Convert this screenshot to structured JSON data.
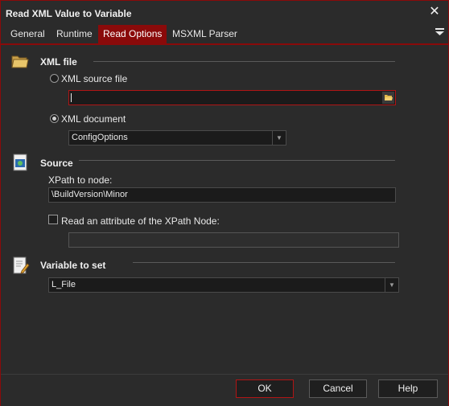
{
  "window": {
    "title": "Read XML Value to Variable",
    "close_glyph": "✕"
  },
  "tabs": [
    {
      "label": "General"
    },
    {
      "label": "Runtime"
    },
    {
      "label": "Read Options"
    },
    {
      "label": "MSXML Parser"
    }
  ],
  "active_tab": "Read Options",
  "xml_file": {
    "title": "XML file",
    "icon": "folder-icon",
    "source_file_label": "XML source file",
    "source_file_value": "",
    "document_label": "XML document",
    "document_value": "ConfigOptions",
    "selected_option": "XML document"
  },
  "source": {
    "title": "Source",
    "icon": "xml-document-icon",
    "xpath_label": "XPath to node:",
    "xpath_value": "\\BuildVersion\\Minor",
    "attribute_checkbox_label": "Read an attribute of the XPath Node:",
    "attribute_checked": false,
    "attribute_value": ""
  },
  "variable": {
    "title": "Variable to set",
    "icon": "edit-document-icon",
    "value": "L_File"
  },
  "footer": {
    "ok_label": "OK",
    "cancel_label": "Cancel",
    "help_label": "Help"
  },
  "colors": {
    "accent": "#8a0a0a",
    "background": "#2b2b2b",
    "input_bg": "#1b1b1b"
  }
}
